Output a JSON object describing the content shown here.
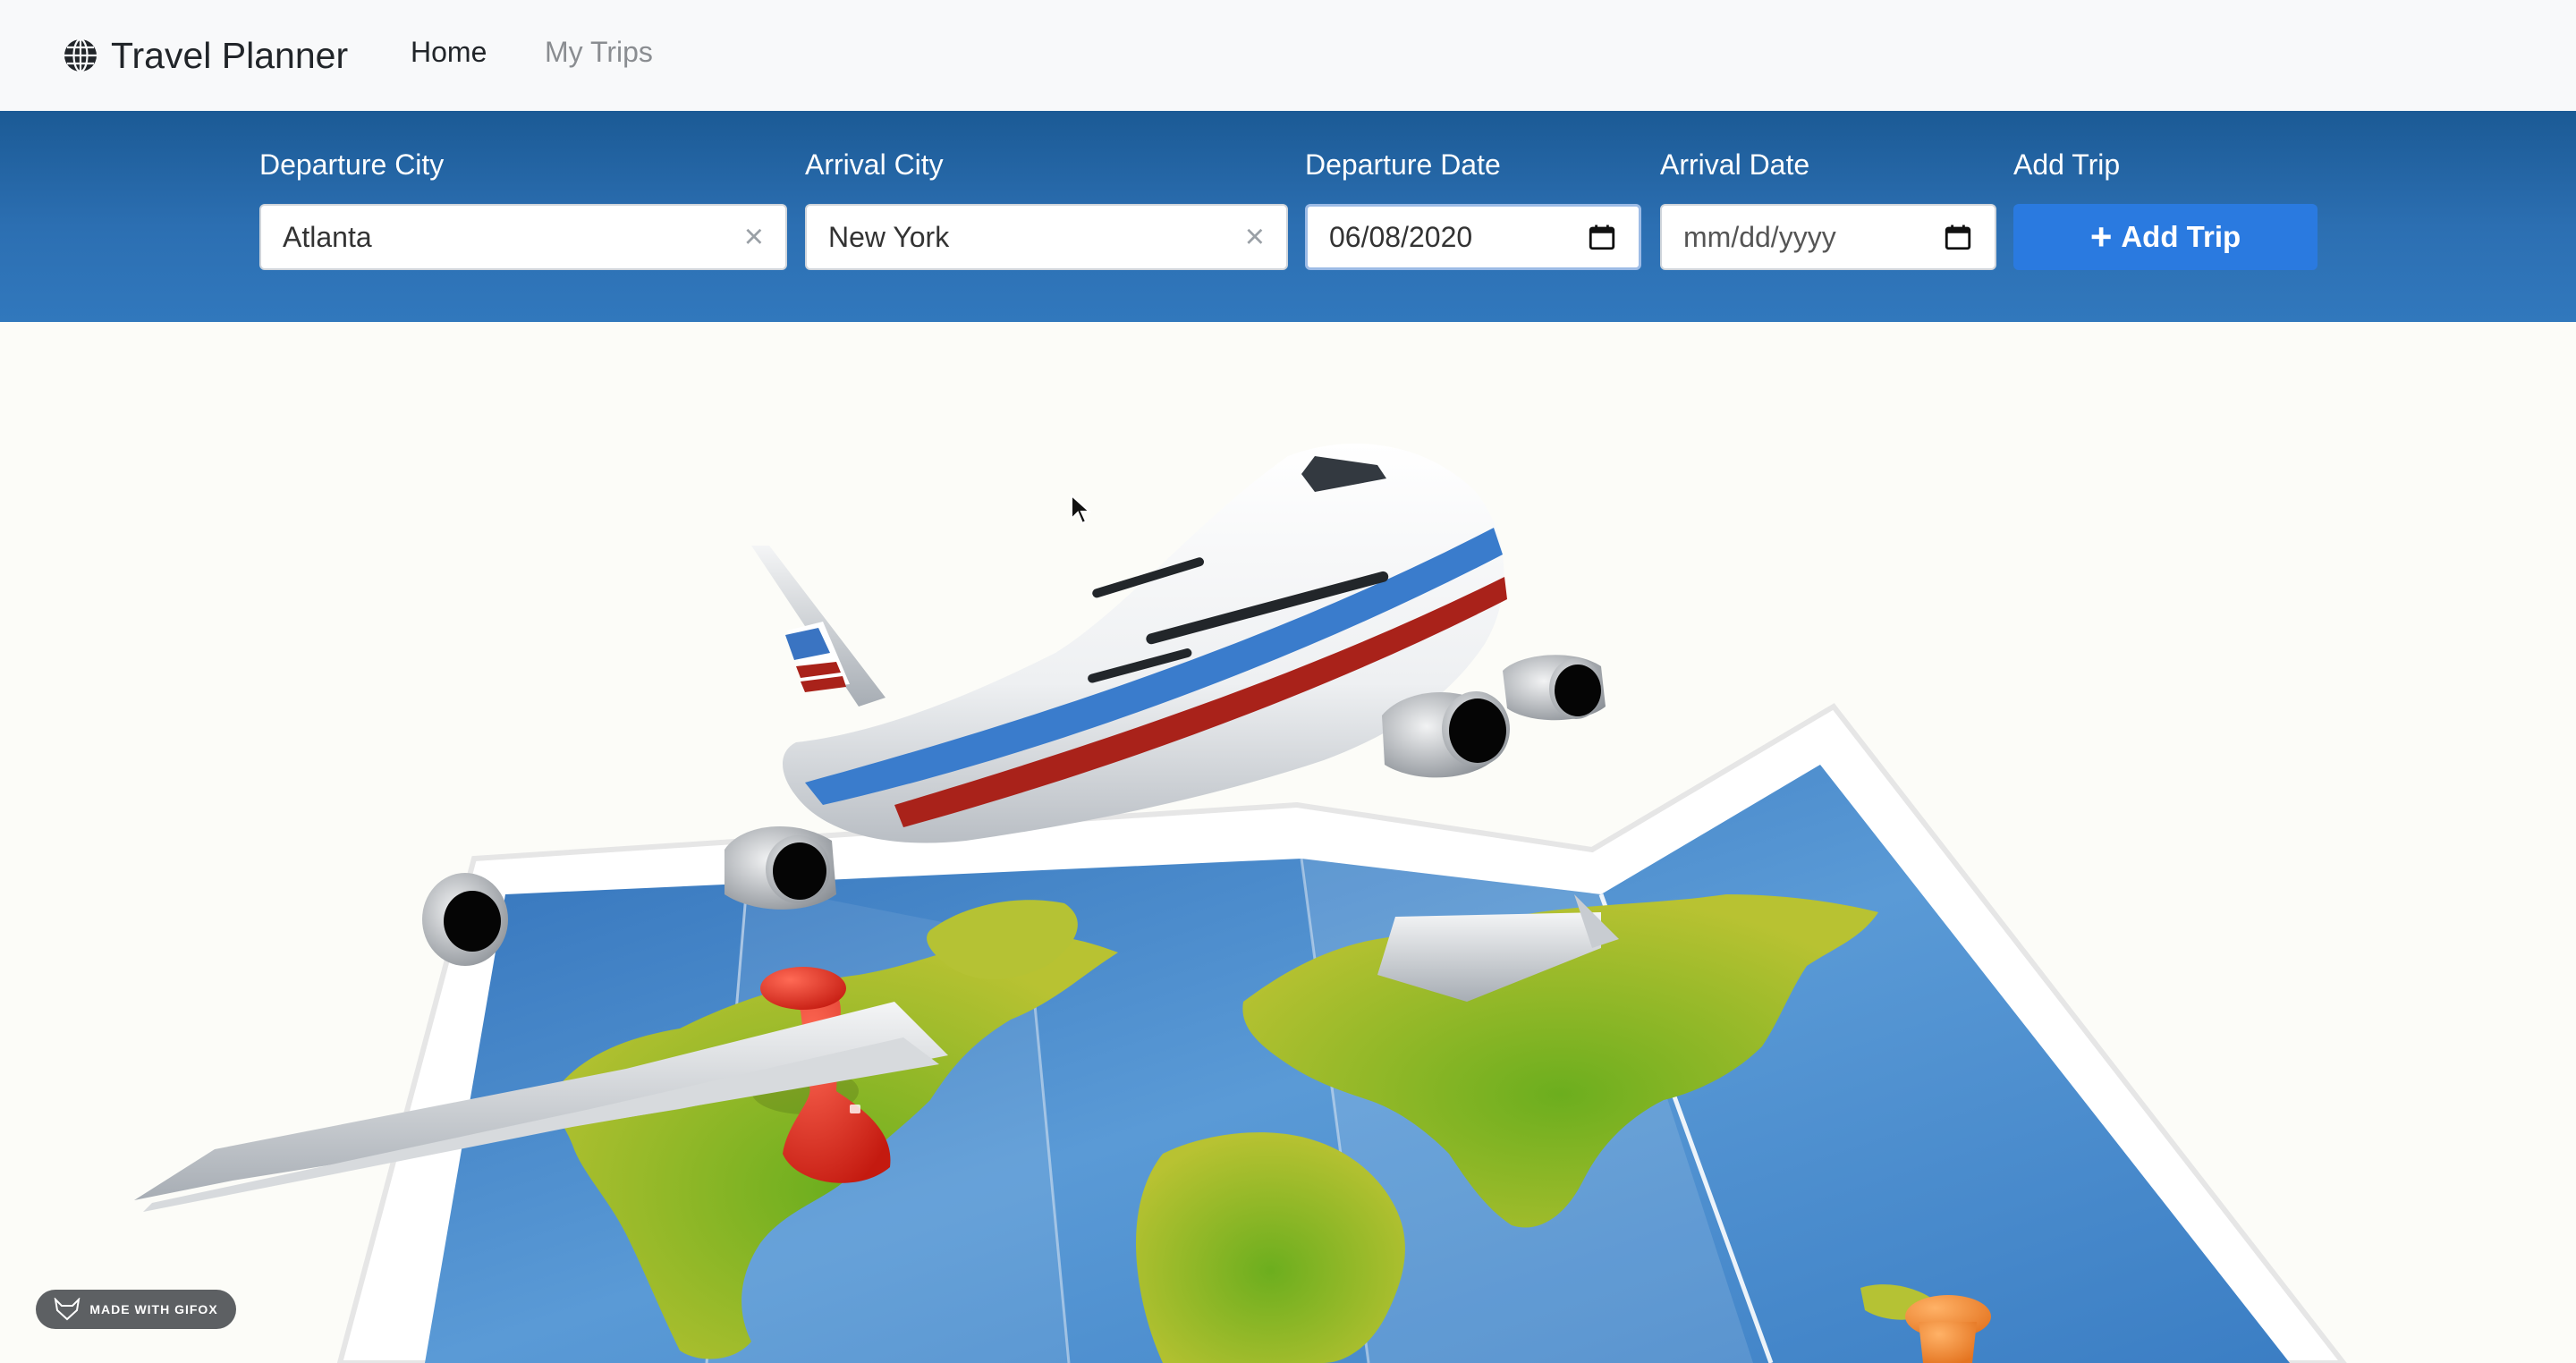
{
  "navbar": {
    "brand": "Travel Planner",
    "brand_icon": "globe-icon",
    "links": [
      {
        "label": "Home",
        "active": true
      },
      {
        "label": "My Trips",
        "active": false
      }
    ]
  },
  "trip_form": {
    "departure_city": {
      "label": "Departure City",
      "value": "Atlanta"
    },
    "arrival_city": {
      "label": "Arrival City",
      "value": "New York"
    },
    "departure_date": {
      "label": "Departure Date",
      "value": "06/08/2020"
    },
    "arrival_date": {
      "label": "Arrival Date",
      "placeholder": "mm/dd/yyyy"
    },
    "add_trip": {
      "label": "Add Trip",
      "button_label": "Add Trip",
      "icon": "plus-icon"
    }
  },
  "badge": {
    "label": "MADE WITH GIFOX"
  },
  "colors": {
    "band_top": "#1b5a95",
    "band_bottom": "#3178bd",
    "button": "#2a7ae0",
    "map_ocean": "#3d83c8",
    "map_land": "#a7be2f",
    "pin_red": "#e3261b"
  }
}
